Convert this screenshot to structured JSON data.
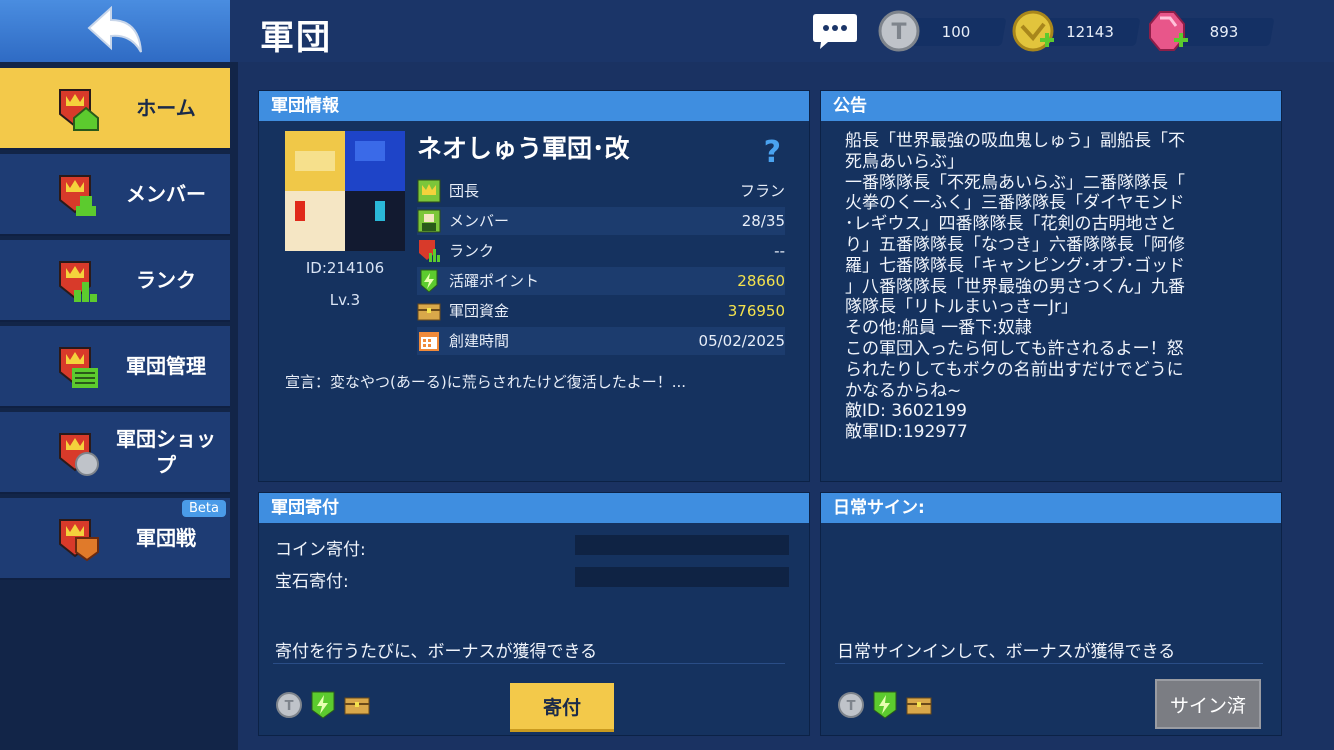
{
  "header": {
    "title": "軍団",
    "currencies": [
      {
        "icon": "silver-coin-icon",
        "value": "100"
      },
      {
        "icon": "gold-coin-icon",
        "value": "12143"
      },
      {
        "icon": "gem-icon",
        "value": "893"
      }
    ]
  },
  "sidebar": {
    "items": [
      {
        "label": "ホーム",
        "icon": "guild-home-icon",
        "active": true
      },
      {
        "label": "メンバー",
        "icon": "guild-members-icon"
      },
      {
        "label": "ランク",
        "icon": "guild-rank-icon"
      },
      {
        "label": "軍団管理",
        "icon": "guild-manage-icon"
      },
      {
        "label": "軍団ショップ",
        "icon": "guild-shop-icon"
      },
      {
        "label": "軍団戦",
        "icon": "guild-war-icon",
        "badge": "Beta"
      }
    ]
  },
  "guild_info": {
    "header": "軍団情報",
    "name": "ネオしゅう軍団･改",
    "id": "ID:214106",
    "level": "Lv.3",
    "rows": [
      {
        "label": "団長",
        "value": "フラン",
        "icon": "leader-icon"
      },
      {
        "label": "メンバー",
        "value": "28/35",
        "icon": "member-icon"
      },
      {
        "label": "ランク",
        "value": "--",
        "icon": "rank-icon"
      },
      {
        "label": "活躍ポイント",
        "value": "28660",
        "icon": "lightning-icon"
      },
      {
        "label": "軍団資金",
        "value": "376950",
        "icon": "chest-icon"
      },
      {
        "label": "創建時間",
        "value": "05/02/2025",
        "icon": "calendar-icon"
      }
    ],
    "declaration": "宣言：変なやつ(あーる)に荒らされたけど復活したよー！..."
  },
  "notice": {
    "header": "公告",
    "lines": [
      "船長「世界最強の吸血鬼しゅう」副船長「不",
      "死鳥あいらぶ」",
      "一番隊隊長「不死鳥あいらぶ」二番隊隊長「",
      "火拳のく一ふく」三番隊隊長「ダイヤモンド",
      "･レギウス」四番隊隊長「花剣の古明地さと",
      "り」五番隊隊長「なつき」六番隊隊長「阿修",
      "羅」七番隊隊長「キャンピング･オブ･ゴッド",
      "」八番隊隊長「世界最強の男さつくん」九番",
      "隊隊長「リトルまいっきーJr」",
      "その他:船員 一番下:奴隷",
      "この軍団入ったら何しても許されるよー！怒",
      "られたりしてもボクの名前出すだけでどうに",
      "かなるからね~",
      "敵ID: 3602199",
      "敵軍ID:192977"
    ]
  },
  "donation": {
    "header": "軍団寄付",
    "coin_label": "コイン寄付:",
    "gem_label": "宝石寄付:",
    "note": "寄付を行うたびに、ボーナスが獲得できる",
    "button": "寄付"
  },
  "daily_sign": {
    "header": "日常サイン:",
    "note": "日常サインインして、ボーナスが獲得できる",
    "button": "サイン済"
  },
  "colors": {
    "accent_yellow": "#f3c94a",
    "header_blue": "#3f8ee0",
    "value_yellow": "#f4e24d"
  }
}
